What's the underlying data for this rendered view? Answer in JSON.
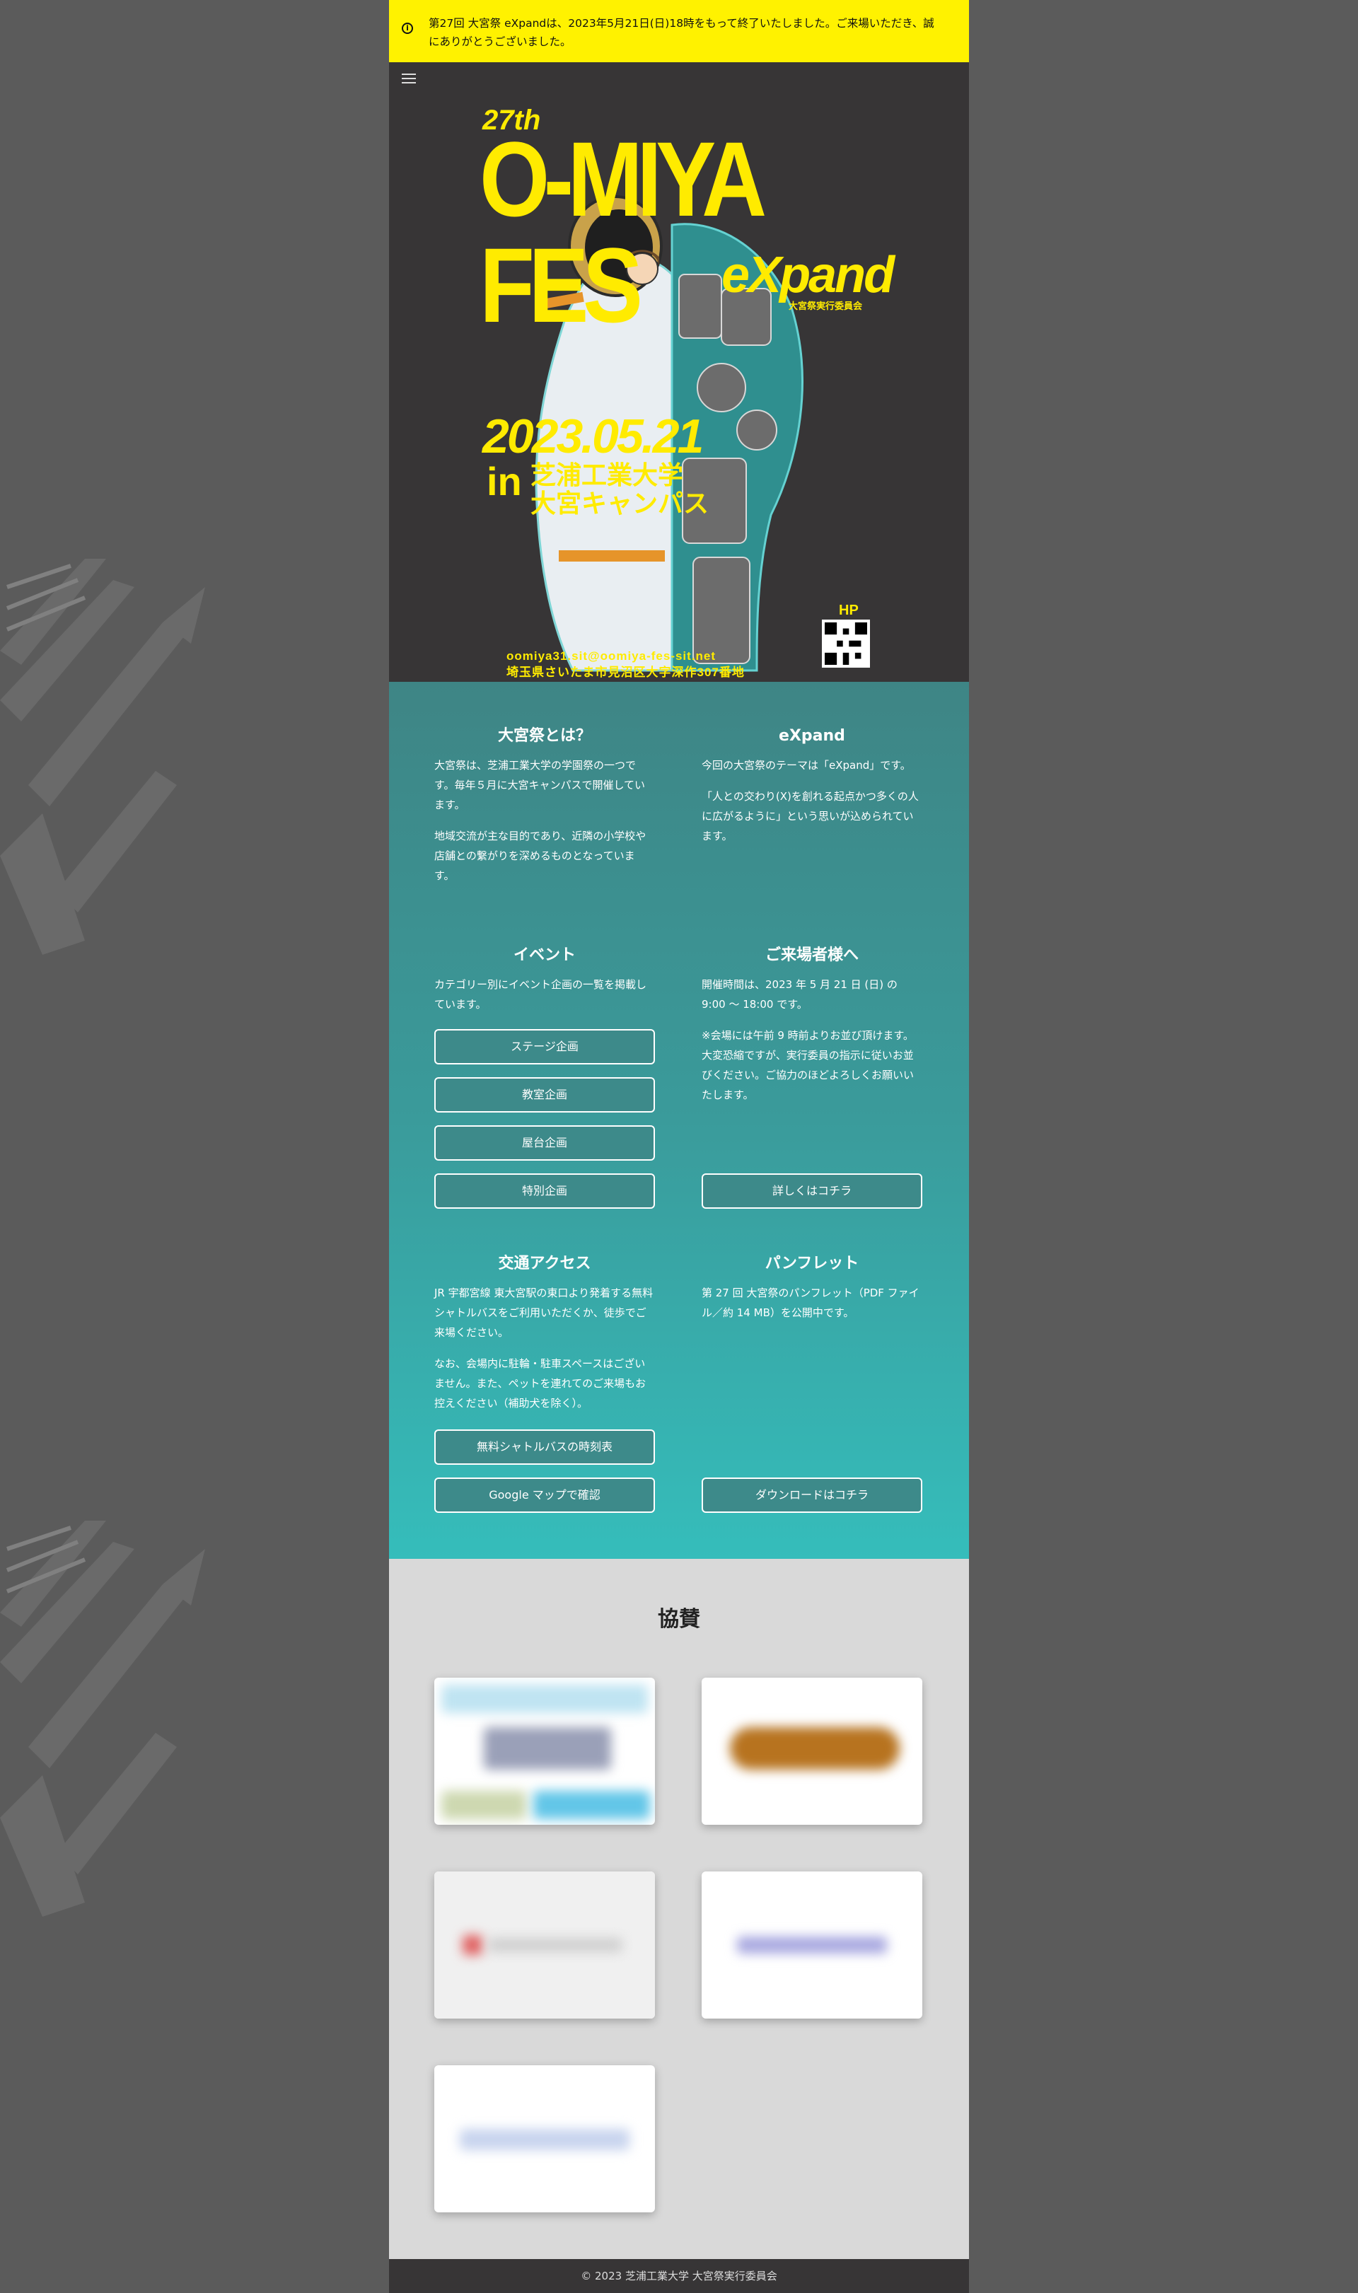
{
  "notice": {
    "text": "第27回 大宮祭 eXpandは、2023年5月21日(日)18時をもって終了いたしました。ご来場いただき、誠にありがとうございました。",
    "icon": "info-icon"
  },
  "poster": {
    "edition": "27th",
    "title": "O-MIYA FES",
    "theme": "eXpand",
    "committee": "大宮祭実行委員会",
    "date": "2023.05.21",
    "in": "in",
    "university": "芝浦工業大学",
    "campus": "大宮キャンパス",
    "hp_label": "HP",
    "contact": "oomiya31.sit@oomiya-fes-sit.net",
    "address": "埼玉県さいたま市見沼区大字深作307番地"
  },
  "about": {
    "title": "大宮祭とは？",
    "p1": "大宮祭は、芝浦工業大学の学園祭の一つです。毎年５月に大宮キャンパスで開催しています。",
    "p2": "地域交流が主な目的であり、近隣の小学校や店舗との繋がりを深めるものとなっています。"
  },
  "expand": {
    "title": "eXpand",
    "p1": "今回の大宮祭のテーマは「eXpand」です。",
    "p2": "「人との交わり(X)を創れる起点かつ多くの人に広がるように」という思いが込められています。"
  },
  "events": {
    "title": "イベント",
    "desc": "カテゴリー別にイベント企画の一覧を掲載しています。",
    "buttons": [
      "ステージ企画",
      "教室企画",
      "屋台企画",
      "特別企画"
    ]
  },
  "visitors": {
    "title": "ご来場者様へ",
    "p1": "開催時間は、2023 年 5 月 21 日 (日) の 9:00 〜 18:00 です。",
    "p2": "※会場には午前 9 時前よりお並び頂けます。大変恐縮ですが、実行委員の指示に従いお並びください。ご協力のほどよろしくお願いいたします。",
    "button": "詳しくはコチラ"
  },
  "access": {
    "title": "交通アクセス",
    "p1": "JR 宇都宮線 東大宮駅の東口より発着する無料シャトルバスをご利用いただくか、徒歩でご来場ください。",
    "p2": "なお、会場内に駐輪・駐車スペースはございません。また、ペットを連れてのご来場もお控えください（補助犬を除く）。",
    "button1": "無料シャトルバスの時刻表",
    "button2": "Google マップで確認"
  },
  "pamphlet": {
    "title": "パンフレット",
    "p1": "第 27 回 大宮祭のパンフレット（PDF ファイル／約 14 MB）を公開中です。",
    "button": "ダウンロードはコチラ"
  },
  "sponsors": {
    "title": "協賛"
  },
  "footer": {
    "text": "© 2023 芝浦工業大学 大宮祭実行委員会"
  },
  "colors": {
    "notice_bg": "#fff200",
    "poster_bg": "#373536",
    "poster_accent": "#ffeb00",
    "teal_top": "#3e8585",
    "teal_bottom": "#35bdbb",
    "sponsors_bg": "#d9d9d9",
    "page_bg": "#5b5b5b"
  }
}
